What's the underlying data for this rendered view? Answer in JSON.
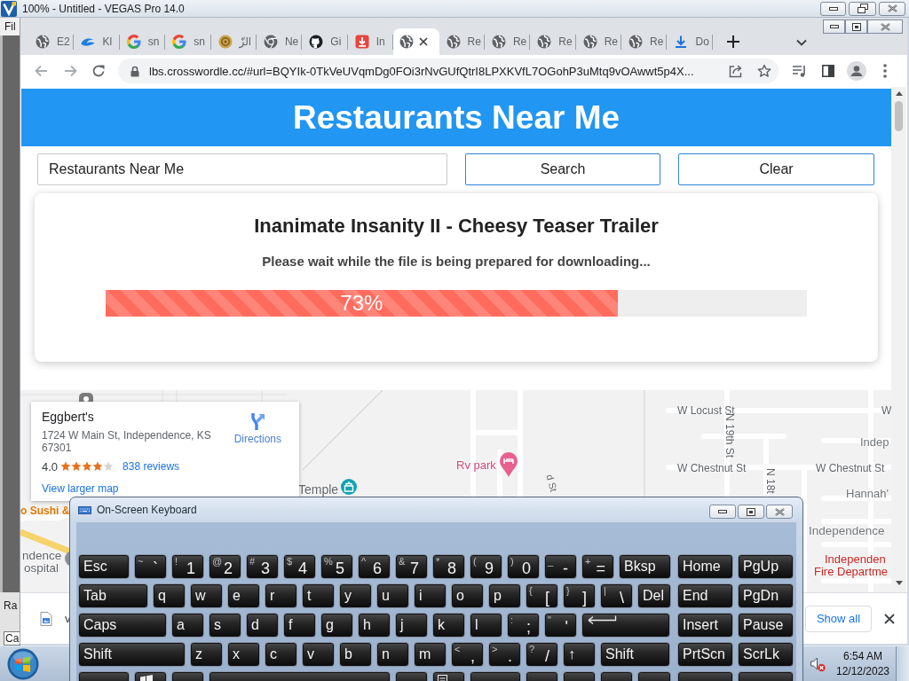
{
  "editor_window": {
    "title": "100% - Untitled - VEGAS Pro 14.0",
    "menu": "Fil",
    "panel_labels": [
      "Ra",
      "Ca"
    ]
  },
  "browser": {
    "tabs": [
      {
        "kind": "globe",
        "label": "E2",
        "selected": false
      },
      {
        "kind": "swoosh",
        "label": "Kl",
        "selected": false
      },
      {
        "kind": "letter-g",
        "label": "sn",
        "selected": false
      },
      {
        "kind": "letter-g",
        "label": "sn",
        "selected": false
      },
      {
        "kind": "emblem",
        "label": "الزّ",
        "selected": false
      },
      {
        "kind": "ring",
        "label": "Ne",
        "selected": false
      },
      {
        "kind": "cat",
        "label": "Gi",
        "selected": false
      },
      {
        "kind": "download-tile",
        "label": "In",
        "selected": false
      },
      {
        "kind": "globe",
        "selected": true
      },
      {
        "kind": "globe",
        "label": "Re",
        "selected": false
      },
      {
        "kind": "globe",
        "label": "Re",
        "selected": false
      },
      {
        "kind": "globe",
        "label": "Re",
        "selected": false
      },
      {
        "kind": "globe",
        "label": "Re",
        "selected": false
      },
      {
        "kind": "globe",
        "label": "Re",
        "selected": false
      },
      {
        "kind": "download-arrow",
        "label": "Do",
        "selected": false
      }
    ],
    "address_bar": {
      "url": "lbs.crosswordle.cc/#url=BQYIk-0TkVeUVqmDg0FOi3rNvGUfQtrI8LPXKVfL7OGohP3uMtq9vOAwwt5p4X..."
    },
    "page": {
      "header": {
        "title": "Restaurants Near Me"
      },
      "search": {
        "value": "Restaurants Near Me"
      },
      "buttons": [
        "Search",
        "Clear"
      ],
      "download_card": {
        "title": "Inanimate Insanity II - Cheesy Teaser Trailer",
        "message": "Please wait while the file is being prepared for downloading...",
        "progress": {
          "level": 0.73,
          "reading": "73%"
        }
      },
      "map": {
        "place": {
          "name": "Eggbert's",
          "address": "1724 W Main St, Independence, KS 67301",
          "rating": "4.0",
          "stars": 4,
          "reviews": "838 reviews",
          "directions": "Directions",
          "larger_map": "View larger map"
        },
        "labels": [
          {
            "text": "W Locust St",
            "kind": "street"
          },
          {
            "text": "W",
            "kind": "street"
          },
          {
            "text": "N 19th St",
            "kind": "street"
          },
          {
            "text": "Indep",
            "kind": "area"
          },
          {
            "text": "Rv park",
            "kind": "lodging"
          },
          {
            "text": "W Chestnut St",
            "kind": "street"
          },
          {
            "text": "W Chestnut St",
            "kind": "street"
          },
          {
            "text": "N 18t",
            "kind": "street"
          },
          {
            "text": "d St",
            "kind": "street"
          },
          {
            "text": "Temple",
            "kind": "landmark"
          },
          {
            "text": "Hannah'",
            "kind": "area"
          },
          {
            "text": "o Sushi &",
            "kind": "food"
          },
          {
            "text": "Independence",
            "kind": "area"
          },
          {
            "text": "ndence",
            "kind": "landmark"
          },
          {
            "text": "ospital",
            "kind": "landmark"
          },
          {
            "text": "Independen",
            "kind": "emergency"
          },
          {
            "text": "Fire Departme",
            "kind": "emergency"
          }
        ]
      }
    },
    "download_shelf": {
      "file_name": "v",
      "show_all": "Show all"
    }
  },
  "keyboard_window": {
    "title": "On-Screen Keyboard",
    "rows": [
      {
        "keys": [
          {
            "kind": "text",
            "label": "Esc"
          },
          {
            "kind": "dual",
            "shift": "~",
            "label": "`"
          },
          {
            "kind": "dual",
            "shift": "!",
            "label": "1"
          },
          {
            "kind": "dual",
            "shift": "@",
            "label": "2"
          },
          {
            "kind": "dual",
            "shift": "#",
            "label": "3"
          },
          {
            "kind": "dual",
            "shift": "$",
            "label": "4"
          },
          {
            "kind": "dual",
            "shift": "%",
            "label": "5"
          },
          {
            "kind": "dual",
            "shift": "^",
            "label": "6"
          },
          {
            "kind": "dual",
            "shift": "&",
            "label": "7"
          },
          {
            "kind": "dual",
            "shift": "*",
            "label": "8"
          },
          {
            "kind": "dual",
            "shift": "(",
            "label": "9"
          },
          {
            "kind": "dual",
            "shift": ")",
            "label": "0"
          },
          {
            "kind": "dual",
            "shift": "_",
            "label": "-"
          },
          {
            "kind": "dual",
            "shift": "+",
            "label": "="
          },
          {
            "kind": "text",
            "label": "Bksp"
          }
        ],
        "nav": [
          {
            "kind": "text",
            "label": "Home"
          },
          {
            "kind": "text",
            "label": "PgUp"
          }
        ]
      },
      {
        "keys": [
          {
            "kind": "text",
            "label": "Tab"
          },
          {
            "kind": "text",
            "label": "q"
          },
          {
            "kind": "text",
            "label": "w"
          },
          {
            "kind": "text",
            "label": "e"
          },
          {
            "kind": "text",
            "label": "r"
          },
          {
            "kind": "text",
            "label": "t"
          },
          {
            "kind": "text",
            "label": "y"
          },
          {
            "kind": "text",
            "label": "u"
          },
          {
            "kind": "text",
            "label": "i"
          },
          {
            "kind": "text",
            "label": "o"
          },
          {
            "kind": "text",
            "label": "p"
          },
          {
            "kind": "dual",
            "shift": "{",
            "label": "["
          },
          {
            "kind": "dual",
            "shift": "}",
            "label": "]"
          },
          {
            "kind": "dual",
            "shift": "|",
            "label": "\\"
          },
          {
            "kind": "text",
            "label": "Del"
          }
        ],
        "nav": [
          {
            "kind": "text",
            "label": "End"
          },
          {
            "kind": "text",
            "label": "PgDn"
          }
        ]
      },
      {
        "keys": [
          {
            "kind": "text",
            "label": "Caps"
          },
          {
            "kind": "text",
            "label": "a"
          },
          {
            "kind": "text",
            "label": "s"
          },
          {
            "kind": "text",
            "label": "d"
          },
          {
            "kind": "text",
            "label": "f"
          },
          {
            "kind": "text",
            "label": "g"
          },
          {
            "kind": "text",
            "label": "h"
          },
          {
            "kind": "text",
            "label": "j"
          },
          {
            "kind": "text",
            "label": "k"
          },
          {
            "kind": "text",
            "label": "l"
          },
          {
            "kind": "dual",
            "shift": ":",
            "label": ";"
          },
          {
            "kind": "dual",
            "shift": "\"",
            "label": "'"
          },
          {
            "kind": "enter"
          }
        ],
        "nav": [
          {
            "kind": "text",
            "label": "Insert"
          },
          {
            "kind": "text",
            "label": "Pause"
          }
        ]
      },
      {
        "keys": [
          {
            "kind": "text",
            "label": "Shift"
          },
          {
            "kind": "text",
            "label": "z"
          },
          {
            "kind": "text",
            "label": "x"
          },
          {
            "kind": "text",
            "label": "c"
          },
          {
            "kind": "text",
            "label": "v"
          },
          {
            "kind": "text",
            "label": "b"
          },
          {
            "kind": "text",
            "label": "n"
          },
          {
            "kind": "text",
            "label": "m"
          },
          {
            "kind": "dual",
            "shift": "<",
            "label": ","
          },
          {
            "kind": "dual",
            "shift": ">",
            "label": "."
          },
          {
            "kind": "dual",
            "shift": "?",
            "label": "/"
          },
          {
            "kind": "text",
            "label": "↑"
          },
          {
            "kind": "text",
            "label": "Shift"
          }
        ],
        "nav": [
          {
            "kind": "text",
            "label": "PrtScn"
          },
          {
            "kind": "text",
            "label": "ScrLk"
          }
        ]
      },
      {
        "keys": [
          {
            "kind": "blank"
          },
          {
            "kind": "windows"
          },
          {
            "kind": "blank"
          },
          {
            "kind": "space"
          },
          {
            "kind": "blank"
          },
          {
            "kind": "menu"
          },
          {
            "kind": "blank"
          },
          {
            "kind": "blank"
          },
          {
            "kind": "blank"
          },
          {
            "kind": "blank"
          },
          {
            "kind": "blank"
          }
        ],
        "nav": [
          {
            "kind": "blank"
          },
          {
            "kind": "blank"
          }
        ]
      }
    ]
  },
  "taskbar": {
    "volume": {
      "muted": true
    },
    "time": "6:54 AM",
    "date": "12/12/2023"
  }
}
